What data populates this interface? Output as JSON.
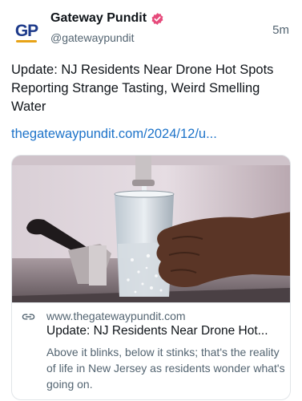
{
  "account": {
    "avatar_text": "GP",
    "display_name": "Gateway Pundit",
    "handle": "@gatewaypundit",
    "verified_icon": "verified-badge-icon",
    "verified_color": "#e64a7b"
  },
  "post": {
    "time": "5m",
    "text": "Update: NJ Residents Near Drone Hot Spots Reporting Strange Tasting, Weird Smelling Water",
    "link": "thegatewaypundit.com/2024/12/u..."
  },
  "card": {
    "image_icon": "water-glass-faucet-photo",
    "link_icon": "link-icon",
    "domain": "www.thegatewaypundit.com",
    "title": "Update: NJ Residents Near Drone Hot...",
    "description": "Above it blinks, below it stinks; that's the reality of life in New Jersey as residents wonder what's going on."
  },
  "colors": {
    "link": "#1d73c9",
    "secondary_text": "#536471",
    "primary_text": "#0f1419"
  }
}
